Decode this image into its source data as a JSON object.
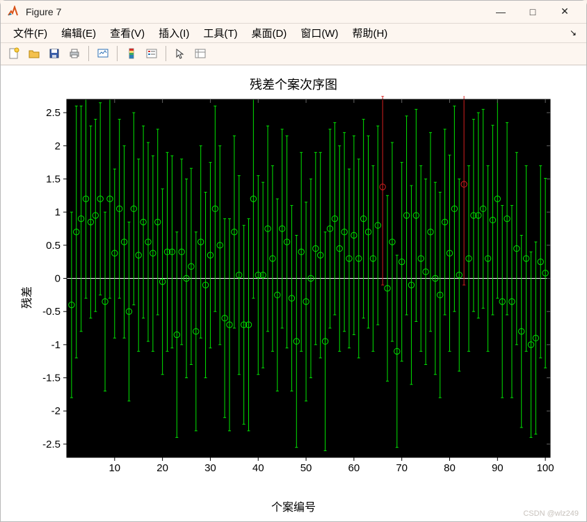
{
  "window": {
    "title": "Figure 7",
    "buttons": {
      "min": "—",
      "max": "□",
      "close": "✕"
    }
  },
  "menubar": {
    "items": [
      "文件(F)",
      "编辑(E)",
      "查看(V)",
      "插入(I)",
      "工具(T)",
      "桌面(D)",
      "窗口(W)",
      "帮助(H)"
    ]
  },
  "toolbar": {
    "new": "new-figure",
    "open": "open",
    "save": "save",
    "print": "print",
    "link": "link",
    "colorbar": "insert-colorbar",
    "legend": "insert-legend",
    "pointer": "pointer",
    "props": "plot-properties"
  },
  "chart_data": {
    "type": "errorbar-scatter",
    "title": "残差个案次序图",
    "xlabel": "个案编号",
    "ylabel": "残差",
    "xlim": [
      0,
      101
    ],
    "ylim": [
      -2.7,
      2.7
    ],
    "xticks": [
      10,
      20,
      30,
      40,
      50,
      60,
      70,
      80,
      90,
      100
    ],
    "yticks": [
      -2.5,
      -2,
      -1.5,
      -1,
      -0.5,
      0,
      0.5,
      1,
      1.5,
      2,
      2.5
    ],
    "points": [
      {
        "x": 1,
        "y": -0.4,
        "lo": -1.8,
        "hi": 1.0,
        "c": "g"
      },
      {
        "x": 2,
        "y": 0.7,
        "lo": -1.2,
        "hi": 2.6,
        "c": "g"
      },
      {
        "x": 3,
        "y": 0.9,
        "lo": -0.8,
        "hi": 2.6,
        "c": "g"
      },
      {
        "x": 4,
        "y": 1.2,
        "lo": -0.3,
        "hi": 2.7,
        "c": "g"
      },
      {
        "x": 5,
        "y": 0.85,
        "lo": -0.6,
        "hi": 2.3,
        "c": "g"
      },
      {
        "x": 6,
        "y": 0.95,
        "lo": -0.5,
        "hi": 2.4,
        "c": "g"
      },
      {
        "x": 7,
        "y": 1.2,
        "lo": -0.25,
        "hi": 2.65,
        "c": "g"
      },
      {
        "x": 8,
        "y": -0.35,
        "lo": -1.7,
        "hi": 1.0,
        "c": "g"
      },
      {
        "x": 9,
        "y": 1.2,
        "lo": -0.3,
        "hi": 2.7,
        "c": "g"
      },
      {
        "x": 10,
        "y": 0.38,
        "lo": -0.9,
        "hi": 1.65,
        "c": "g"
      },
      {
        "x": 11,
        "y": 1.05,
        "lo": -0.3,
        "hi": 2.4,
        "c": "g"
      },
      {
        "x": 12,
        "y": 0.55,
        "lo": -0.9,
        "hi": 2.0,
        "c": "g"
      },
      {
        "x": 13,
        "y": -0.5,
        "lo": -1.85,
        "hi": 0.85,
        "c": "g"
      },
      {
        "x": 14,
        "y": 1.05,
        "lo": -0.4,
        "hi": 2.5,
        "c": "g"
      },
      {
        "x": 15,
        "y": 0.35,
        "lo": -1.1,
        "hi": 1.8,
        "c": "g"
      },
      {
        "x": 16,
        "y": 0.85,
        "lo": -0.6,
        "hi": 2.3,
        "c": "g"
      },
      {
        "x": 17,
        "y": 0.55,
        "lo": -0.95,
        "hi": 2.05,
        "c": "g"
      },
      {
        "x": 18,
        "y": 0.38,
        "lo": -1.1,
        "hi": 1.85,
        "c": "g"
      },
      {
        "x": 19,
        "y": 0.85,
        "lo": -0.55,
        "hi": 2.25,
        "c": "g"
      },
      {
        "x": 20,
        "y": -0.05,
        "lo": -1.45,
        "hi": 1.35,
        "c": "g"
      },
      {
        "x": 21,
        "y": 0.4,
        "lo": -1.1,
        "hi": 1.9,
        "c": "g"
      },
      {
        "x": 22,
        "y": 0.4,
        "lo": -1.05,
        "hi": 1.85,
        "c": "g"
      },
      {
        "x": 23,
        "y": -0.85,
        "lo": -2.4,
        "hi": 0.7,
        "c": "g"
      },
      {
        "x": 24,
        "y": 0.4,
        "lo": -1.0,
        "hi": 1.8,
        "c": "g"
      },
      {
        "x": 25,
        "y": 0.0,
        "lo": -1.5,
        "hi": 1.5,
        "c": "g"
      },
      {
        "x": 26,
        "y": 0.18,
        "lo": -1.3,
        "hi": 1.66,
        "c": "g"
      },
      {
        "x": 27,
        "y": -0.8,
        "lo": -2.3,
        "hi": 0.7,
        "c": "g"
      },
      {
        "x": 28,
        "y": 0.55,
        "lo": -0.9,
        "hi": 2.0,
        "c": "g"
      },
      {
        "x": 29,
        "y": -0.1,
        "lo": -1.5,
        "hi": 1.3,
        "c": "g"
      },
      {
        "x": 30,
        "y": 0.35,
        "lo": -1.05,
        "hi": 1.75,
        "c": "g"
      },
      {
        "x": 31,
        "y": 1.05,
        "lo": -0.5,
        "hi": 2.6,
        "c": "g"
      },
      {
        "x": 32,
        "y": 0.5,
        "lo": -1.0,
        "hi": 2.0,
        "c": "g"
      },
      {
        "x": 33,
        "y": -0.6,
        "lo": -2.1,
        "hi": 0.9,
        "c": "g"
      },
      {
        "x": 34,
        "y": -0.7,
        "lo": -2.3,
        "hi": 0.9,
        "c": "g"
      },
      {
        "x": 35,
        "y": 0.7,
        "lo": -0.75,
        "hi": 2.15,
        "c": "g"
      },
      {
        "x": 36,
        "y": 0.05,
        "lo": -1.45,
        "hi": 1.55,
        "c": "g"
      },
      {
        "x": 37,
        "y": -0.7,
        "lo": -2.2,
        "hi": 0.8,
        "c": "g"
      },
      {
        "x": 38,
        "y": -0.7,
        "lo": -2.3,
        "hi": 0.9,
        "c": "g"
      },
      {
        "x": 39,
        "y": 1.2,
        "lo": -0.3,
        "hi": 2.7,
        "c": "g"
      },
      {
        "x": 40,
        "y": 0.05,
        "lo": -1.45,
        "hi": 1.55,
        "c": "g"
      },
      {
        "x": 41,
        "y": 0.05,
        "lo": -1.35,
        "hi": 1.45,
        "c": "g"
      },
      {
        "x": 42,
        "y": 0.75,
        "lo": -0.8,
        "hi": 2.3,
        "c": "g"
      },
      {
        "x": 43,
        "y": 0.3,
        "lo": -1.1,
        "hi": 1.7,
        "c": "g"
      },
      {
        "x": 44,
        "y": -0.25,
        "lo": -1.7,
        "hi": 1.2,
        "c": "g"
      },
      {
        "x": 45,
        "y": 0.75,
        "lo": -0.75,
        "hi": 2.25,
        "c": "g"
      },
      {
        "x": 46,
        "y": 0.55,
        "lo": -1.05,
        "hi": 2.15,
        "c": "g"
      },
      {
        "x": 47,
        "y": -0.3,
        "lo": -1.7,
        "hi": 1.1,
        "c": "g"
      },
      {
        "x": 48,
        "y": -0.95,
        "lo": -2.55,
        "hi": 0.65,
        "c": "g"
      },
      {
        "x": 49,
        "y": 0.4,
        "lo": -1.1,
        "hi": 1.9,
        "c": "g"
      },
      {
        "x": 50,
        "y": -0.35,
        "lo": -1.85,
        "hi": 1.15,
        "c": "g"
      },
      {
        "x": 51,
        "y": 0.0,
        "lo": -1.5,
        "hi": 1.5,
        "c": "g"
      },
      {
        "x": 52,
        "y": 0.45,
        "lo": -1.0,
        "hi": 1.9,
        "c": "g"
      },
      {
        "x": 53,
        "y": 0.35,
        "lo": -1.2,
        "hi": 1.9,
        "c": "g"
      },
      {
        "x": 54,
        "y": -0.95,
        "lo": -2.6,
        "hi": 0.7,
        "c": "g"
      },
      {
        "x": 55,
        "y": 0.75,
        "lo": -0.75,
        "hi": 2.25,
        "c": "g"
      },
      {
        "x": 56,
        "y": 0.9,
        "lo": -0.55,
        "hi": 2.35,
        "c": "g"
      },
      {
        "x": 57,
        "y": 0.45,
        "lo": -1.1,
        "hi": 2.0,
        "c": "g"
      },
      {
        "x": 58,
        "y": 0.7,
        "lo": -0.8,
        "hi": 2.2,
        "c": "g"
      },
      {
        "x": 59,
        "y": 0.3,
        "lo": -1.05,
        "hi": 1.65,
        "c": "g"
      },
      {
        "x": 60,
        "y": 0.65,
        "lo": -0.85,
        "hi": 2.15,
        "c": "g"
      },
      {
        "x": 61,
        "y": 0.3,
        "lo": -1.2,
        "hi": 1.8,
        "c": "g"
      },
      {
        "x": 62,
        "y": 0.9,
        "lo": -0.6,
        "hi": 2.4,
        "c": "g"
      },
      {
        "x": 63,
        "y": 0.7,
        "lo": -0.75,
        "hi": 2.15,
        "c": "g"
      },
      {
        "x": 64,
        "y": 0.3,
        "lo": -1.1,
        "hi": 1.7,
        "c": "g"
      },
      {
        "x": 65,
        "y": 0.8,
        "lo": -0.7,
        "hi": 2.3,
        "c": "g"
      },
      {
        "x": 66,
        "y": 1.38,
        "lo": -0.1,
        "hi": 2.75,
        "c": "r"
      },
      {
        "x": 67,
        "y": -0.15,
        "lo": -1.55,
        "hi": 1.25,
        "c": "g"
      },
      {
        "x": 68,
        "y": 0.55,
        "lo": -0.95,
        "hi": 2.05,
        "c": "g"
      },
      {
        "x": 69,
        "y": -1.1,
        "lo": -2.55,
        "hi": 0.35,
        "c": "g"
      },
      {
        "x": 70,
        "y": 0.25,
        "lo": -1.25,
        "hi": 1.75,
        "c": "g"
      },
      {
        "x": 71,
        "y": 0.95,
        "lo": -0.55,
        "hi": 2.45,
        "c": "g"
      },
      {
        "x": 72,
        "y": -0.1,
        "lo": -1.6,
        "hi": 1.4,
        "c": "g"
      },
      {
        "x": 73,
        "y": 0.95,
        "lo": -0.65,
        "hi": 2.55,
        "c": "g"
      },
      {
        "x": 74,
        "y": 0.3,
        "lo": -1.1,
        "hi": 1.7,
        "c": "g"
      },
      {
        "x": 75,
        "y": 0.1,
        "lo": -1.3,
        "hi": 1.5,
        "c": "g"
      },
      {
        "x": 76,
        "y": 0.7,
        "lo": -0.8,
        "hi": 2.2,
        "c": "g"
      },
      {
        "x": 77,
        "y": 0.0,
        "lo": -1.45,
        "hi": 1.45,
        "c": "g"
      },
      {
        "x": 78,
        "y": -0.25,
        "lo": -1.8,
        "hi": 1.3,
        "c": "g"
      },
      {
        "x": 79,
        "y": 0.85,
        "lo": -0.55,
        "hi": 2.25,
        "c": "g"
      },
      {
        "x": 80,
        "y": 0.38,
        "lo": -1.1,
        "hi": 1.86,
        "c": "g"
      },
      {
        "x": 81,
        "y": 1.05,
        "lo": -0.5,
        "hi": 2.6,
        "c": "g"
      },
      {
        "x": 82,
        "y": 0.05,
        "lo": -1.4,
        "hi": 1.5,
        "c": "g"
      },
      {
        "x": 83,
        "y": 1.42,
        "lo": -0.1,
        "hi": 2.78,
        "c": "r"
      },
      {
        "x": 84,
        "y": 0.3,
        "lo": -1.1,
        "hi": 1.7,
        "c": "g"
      },
      {
        "x": 85,
        "y": 0.95,
        "lo": -0.5,
        "hi": 2.4,
        "c": "g"
      },
      {
        "x": 86,
        "y": 0.95,
        "lo": -0.6,
        "hi": 2.5,
        "c": "g"
      },
      {
        "x": 87,
        "y": 1.05,
        "lo": -0.45,
        "hi": 2.55,
        "c": "g"
      },
      {
        "x": 88,
        "y": 0.3,
        "lo": -1.1,
        "hi": 1.7,
        "c": "g"
      },
      {
        "x": 89,
        "y": 0.88,
        "lo": -0.55,
        "hi": 2.31,
        "c": "g"
      },
      {
        "x": 90,
        "y": 1.2,
        "lo": -0.3,
        "hi": 2.7,
        "c": "g"
      },
      {
        "x": 91,
        "y": -0.35,
        "lo": -1.8,
        "hi": 1.1,
        "c": "g"
      },
      {
        "x": 92,
        "y": 0.9,
        "lo": -0.55,
        "hi": 2.35,
        "c": "g"
      },
      {
        "x": 93,
        "y": -0.35,
        "lo": -1.8,
        "hi": 1.1,
        "c": "g"
      },
      {
        "x": 94,
        "y": 0.45,
        "lo": -1.0,
        "hi": 1.9,
        "c": "g"
      },
      {
        "x": 95,
        "y": -0.8,
        "lo": -2.25,
        "hi": 0.65,
        "c": "g"
      },
      {
        "x": 96,
        "y": 0.3,
        "lo": -1.1,
        "hi": 1.7,
        "c": "g"
      },
      {
        "x": 97,
        "y": -1.0,
        "lo": -2.4,
        "hi": 0.4,
        "c": "g"
      },
      {
        "x": 98,
        "y": -0.9,
        "lo": -2.35,
        "hi": 0.55,
        "c": "g"
      },
      {
        "x": 99,
        "y": 0.25,
        "lo": -1.2,
        "hi": 1.7,
        "c": "g"
      },
      {
        "x": 100,
        "y": 0.08,
        "lo": -1.35,
        "hi": 1.51,
        "c": "g"
      }
    ]
  },
  "watermark": "CSDN @wlz249"
}
